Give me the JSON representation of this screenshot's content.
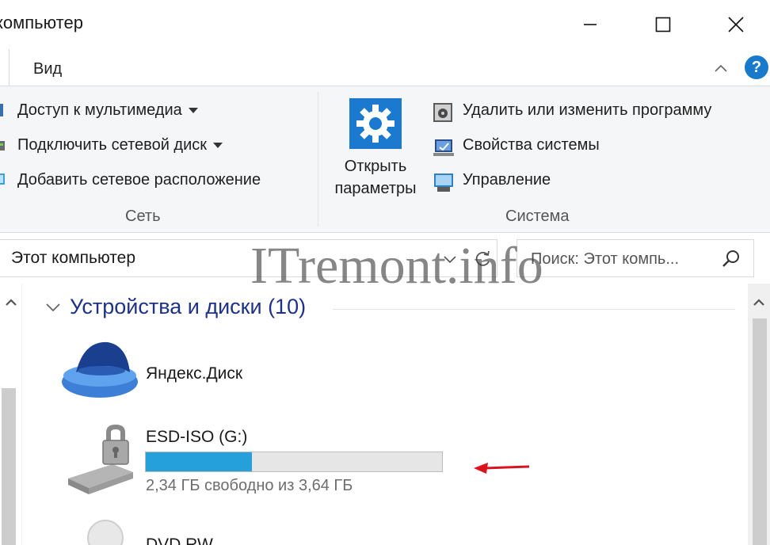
{
  "window": {
    "title": "компьютер",
    "controls": {
      "minimize": "minimize",
      "maximize": "maximize",
      "close": "close"
    }
  },
  "ribbon": {
    "tab_label": "Вид",
    "help_label": "?",
    "network_group": {
      "label": "Сеть",
      "items": [
        {
          "label": "Доступ к мультимедиа",
          "icon": "media-access-icon",
          "dropdown": true
        },
        {
          "label": "Подключить сетевой диск",
          "icon": "network-drive-icon",
          "dropdown": true
        },
        {
          "label": "Добавить сетевое расположение",
          "icon": "network-location-icon",
          "dropdown": false
        }
      ]
    },
    "system_group": {
      "label": "Система",
      "settings_button": {
        "line1": "Открыть",
        "line2": "параметры",
        "icon": "gear-icon"
      },
      "items": [
        {
          "label": "Удалить или изменить программу",
          "icon": "programs-icon"
        },
        {
          "label": "Свойства системы",
          "icon": "system-properties-icon"
        },
        {
          "label": "Управление",
          "icon": "computer-management-icon"
        }
      ]
    }
  },
  "address_bar": {
    "path": "Этот компьютер",
    "search_placeholder": "Поиск: Этот компь..."
  },
  "watermark": "ITremont.info",
  "content": {
    "group_title": "Устройства и диски (10)",
    "drives": [
      {
        "name": "Яндекс.Диск",
        "icon": "yandex-disk-icon"
      },
      {
        "name": "ESD-ISO (G:)",
        "icon": "locked-usb-drive-icon",
        "free_text": "2,34 ГБ свободно из 3,64 ГБ",
        "used_fraction": 0.357
      },
      {
        "name": "DVD RW",
        "icon": "dvd-drive-icon"
      }
    ]
  },
  "colors": {
    "accent": "#1b7ad0",
    "usage_fill": "#26a0da",
    "group_header": "#1e3287",
    "annotation_arrow": "#d9141e"
  }
}
